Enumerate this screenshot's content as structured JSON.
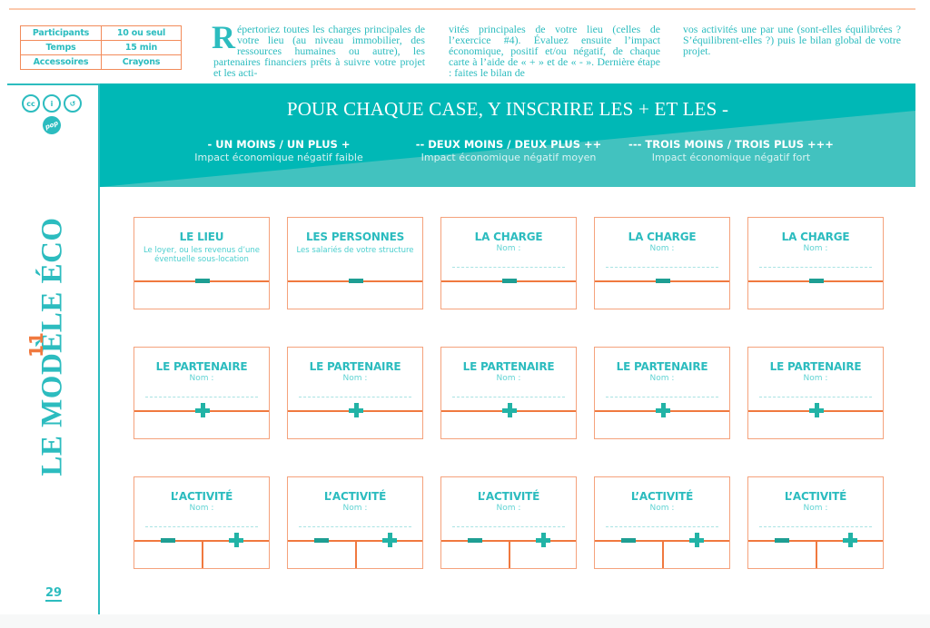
{
  "info_table": [
    {
      "key": "Participants",
      "value": "10 ou seul"
    },
    {
      "key": "Temps",
      "value": "15 min"
    },
    {
      "key": "Accessoires",
      "value": "Crayons"
    }
  ],
  "intro": {
    "dropcap": "R",
    "col1": "épertoriez toutes les charges principales de votre lieu (au niveau immobilier, des ressources humaines ou autre), les partenaires financiers prêts à suivre votre projet et les acti-",
    "col2": "vités principales de votre lieu (celles de l’exercice #4). Évaluez ensuite l’impact économique, positif et/ou négatif, de chaque carte à l’aide de « + » et de « - ». Dernière étape : faites le bilan de",
    "col3": "vos activités une par une (sont-elles équilibrées ? S’équilibrent-elles ?) puis le bilan global de votre projet."
  },
  "sidebar": {
    "licenses": [
      "cc-icon",
      "attribution-icon",
      "share-alike-icon"
    ],
    "license_labels": [
      "cc",
      "i",
      "↺"
    ],
    "pop_badge": "pop",
    "chapter_number": "11",
    "chapter_title": "LE MODÈLE ÉCO",
    "page_number": "29"
  },
  "banner": {
    "title": "POUR CHAQUE CASE, Y INSCRIRE LES + ET LES -",
    "legend": [
      {
        "heading": "- UN MOINS / UN PLUS +",
        "subtitle": "Impact économique négatif faible"
      },
      {
        "heading": "-- DEUX MOINS / DEUX PLUS ++",
        "subtitle": "Impact économique négatif moyen"
      },
      {
        "heading": "--- TROIS MOINS / TROIS PLUS +++",
        "subtitle": "Impact économique négatif fort"
      }
    ],
    "colors": {
      "dark": "#00b8b6",
      "light": "#42c2bf"
    }
  },
  "cards": {
    "row1": [
      {
        "title": "LE LIEU",
        "subtitle": "Le loyer, ou les revenus d’une éventuelle sous-location",
        "sign": "minus"
      },
      {
        "title": "LES PERSONNES",
        "subtitle": "Les salariés de votre structure",
        "sign": "minus"
      },
      {
        "title": "LA CHARGE",
        "nom": "Nom :",
        "sign": "minus"
      },
      {
        "title": "LA CHARGE",
        "nom": "Nom :",
        "sign": "minus"
      },
      {
        "title": "LA CHARGE",
        "nom": "Nom :",
        "sign": "minus"
      }
    ],
    "row2": [
      {
        "title": "LE PARTENAIRE",
        "nom": "Nom :",
        "sign": "plus"
      },
      {
        "title": "LE PARTENAIRE",
        "nom": "Nom :",
        "sign": "plus"
      },
      {
        "title": "LE PARTENAIRE",
        "nom": "Nom :",
        "sign": "plus"
      },
      {
        "title": "LE PARTENAIRE",
        "nom": "Nom :",
        "sign": "plus"
      },
      {
        "title": "LE PARTENAIRE",
        "nom": "Nom :",
        "sign": "plus"
      }
    ],
    "row3": [
      {
        "title": "L’ACTIVITÉ",
        "nom": "Nom :",
        "sign": "both"
      },
      {
        "title": "L’ACTIVITÉ",
        "nom": "Nom :",
        "sign": "both"
      },
      {
        "title": "L’ACTIVITÉ",
        "nom": "Nom :",
        "sign": "both"
      },
      {
        "title": "L’ACTIVITÉ",
        "nom": "Nom :",
        "sign": "both"
      },
      {
        "title": "L’ACTIVITÉ",
        "nom": "Nom :",
        "sign": "both"
      }
    ]
  },
  "colors": {
    "teal": "#2cbcbf",
    "orange": "#f0793f",
    "card_border": "#f5a27c"
  }
}
